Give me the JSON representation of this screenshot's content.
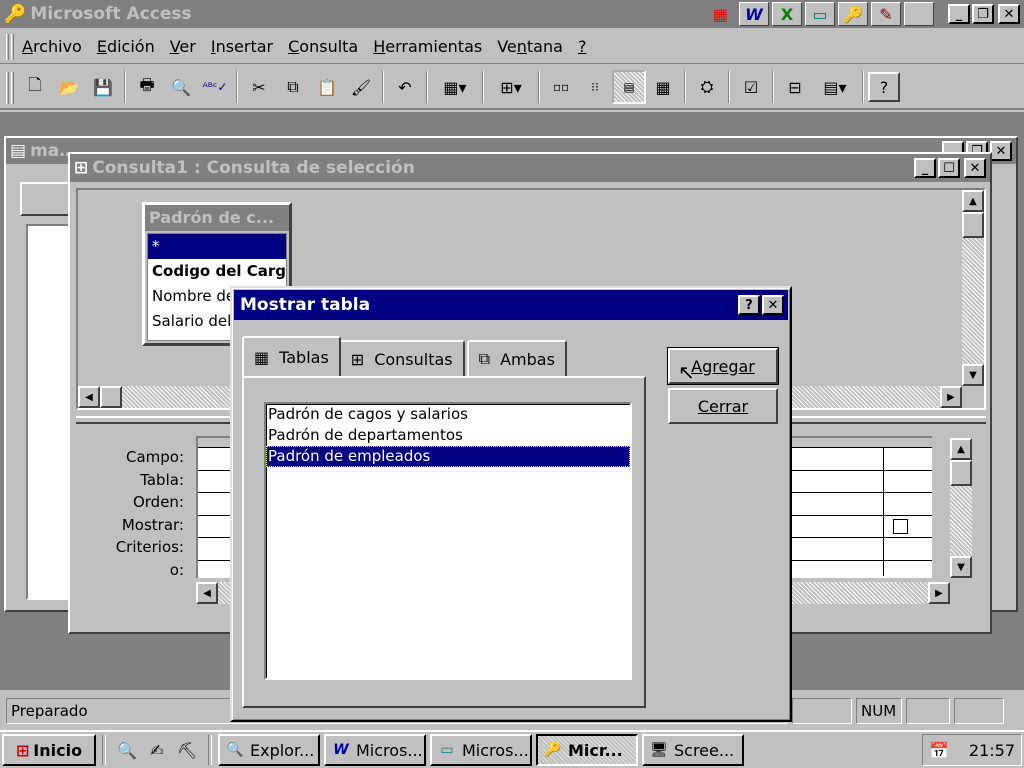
{
  "app": {
    "title": "Microsoft Access",
    "menu": [
      "Archivo",
      "Edición",
      "Ver",
      "Insertar",
      "Consulta",
      "Herramientas",
      "Ventana",
      "?"
    ],
    "office_shortcuts": [
      "W",
      "X",
      "▭",
      "🔑",
      "✎",
      "⚗"
    ]
  },
  "back_window": {
    "title": "ma…"
  },
  "query_window": {
    "title": "Consulta1 : Consulta de selección",
    "field_list": {
      "title": "Padrón de c...",
      "items": [
        "*",
        "Codigo del Cargo",
        "Nombre de",
        "Salario del"
      ]
    },
    "grid_labels": [
      "Campo:",
      "Tabla:",
      "Orden:",
      "Mostrar:",
      "Criterios:",
      "o:"
    ]
  },
  "dialog": {
    "title": "Mostrar tabla",
    "help_label": "?",
    "close_label": "✕",
    "tabs": [
      "Tablas",
      "Consultas",
      "Ambas"
    ],
    "items": [
      "Padrón de cagos y salarios",
      "Padrón de departamentos",
      "Padrón de empleados"
    ],
    "buttons": {
      "add": "Agregar",
      "close": "Cerrar"
    }
  },
  "status": {
    "text": "Preparado",
    "num": "NUM"
  },
  "taskbar": {
    "start": "Inicio",
    "tasks": [
      "Explor...",
      "Micros...",
      "Micros...",
      "Micr...",
      "Scree..."
    ],
    "clock": "21:57"
  },
  "colors": {
    "face": "#c0c0c0",
    "active_title": "#000080",
    "inactive_title": "#808080",
    "desktop": "#808080"
  }
}
